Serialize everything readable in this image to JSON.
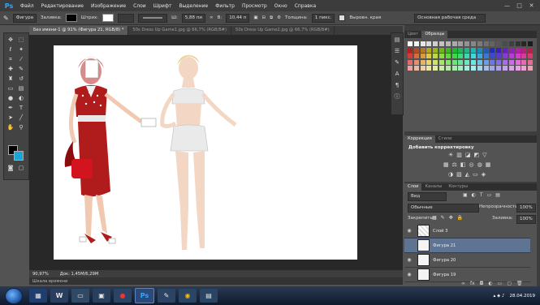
{
  "menu": {
    "logo": "Ps",
    "items": [
      "Файл",
      "Редактирование",
      "Изображение",
      "Слои",
      "Шрифт",
      "Выделение",
      "Фильтр",
      "Просмотр",
      "Окно",
      "Справка"
    ],
    "window_controls": [
      "—",
      "□",
      "✕"
    ]
  },
  "options": {
    "shape_mode": "Фигура",
    "fill_label": "Заливка:",
    "stroke_label": "Штрих:",
    "stroke_width": "",
    "w_label": "Ш:",
    "w_value": "5,88 пи",
    "h_label": "В:",
    "h_value": "10,44 п",
    "thickness_label": "Толщина:",
    "thickness_value": "1 пикс.",
    "align_edges_label": "Выровн. края",
    "workspace": "Основная рабочая среда"
  },
  "tabs": [
    "Без имени-1 @ 91% (Фигура 21, RGB/8) *",
    "50s Dress Up Game1.jpg @ 66,7% (RGB/8#)",
    "50s Dress Up Game2.jpg @ 66,7% (RGB/8#)"
  ],
  "status": {
    "zoom": "90,97%",
    "doc": "Док: 1,45М/6,29М",
    "timeline": "Шкала времени"
  },
  "swatches_panel": {
    "tabs": [
      "Цвет",
      "Образцы"
    ]
  },
  "adjustments": {
    "tabs": [
      "Коррекция",
      "Стили"
    ],
    "title": "Добавить корректировку"
  },
  "layers": {
    "tabs": [
      "Слои",
      "Каналы",
      "Контуры"
    ],
    "kind": "Вид",
    "blend_mode": "Обычные",
    "opacity_label": "Непрозрачность:",
    "opacity_value": "100%",
    "lock_label": "Закрепить:",
    "fill_label": "Заливка:",
    "fill_value": "100%",
    "items": [
      {
        "name": "Слой 3"
      },
      {
        "name": "Фигура 21"
      },
      {
        "name": "Фигура 20"
      },
      {
        "name": "Фигура 19"
      }
    ]
  },
  "taskbar": {
    "time": "28.04.2019",
    "ps_label": "Ps"
  },
  "colors": {
    "accent": "#31a8ff",
    "selected_layer": "#5f7493",
    "dress_red": "#b01c1c",
    "foreground": "#000000",
    "background": "#18a6d6"
  }
}
